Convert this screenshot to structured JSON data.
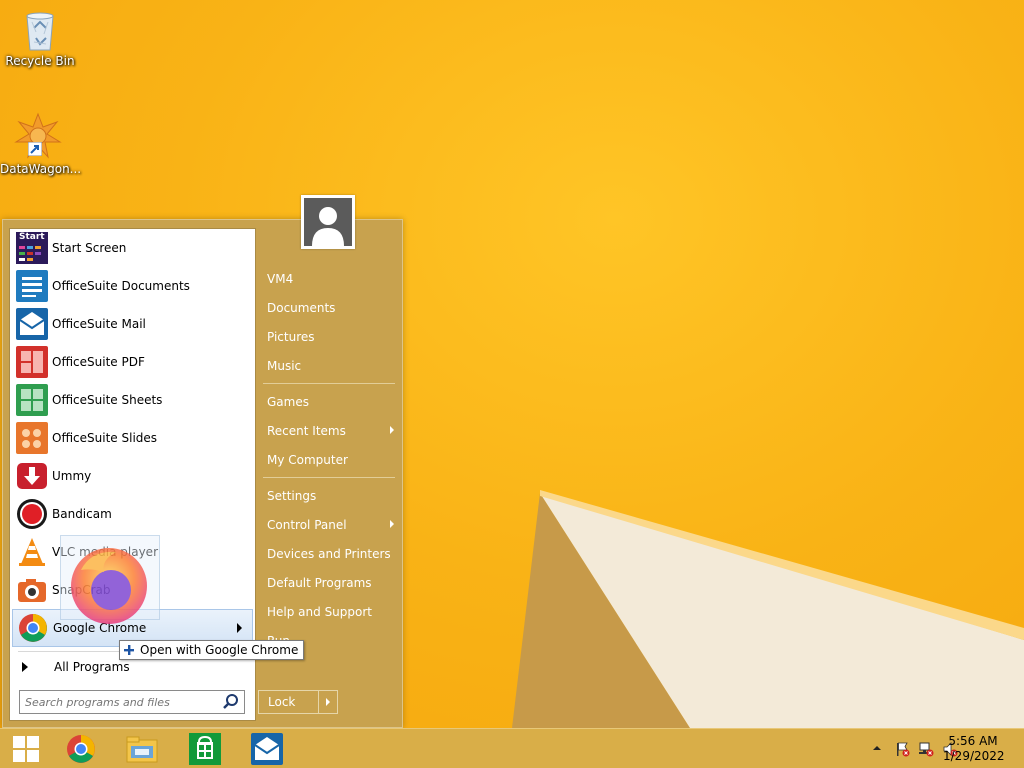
{
  "desktop": {
    "icons": [
      {
        "label": "Recycle Bin",
        "icon": "recycle-bin-icon"
      },
      {
        "label": "DataWagon...",
        "icon": "datawagon-icon"
      }
    ]
  },
  "start_menu": {
    "programs": [
      {
        "label": "Start Screen",
        "icon": "start-screen-icon",
        "tile_text": "Start"
      },
      {
        "label": "OfficeSuite Documents",
        "icon": "officesuite-documents-icon"
      },
      {
        "label": "OfficeSuite Mail",
        "icon": "officesuite-mail-icon"
      },
      {
        "label": "OfficeSuite PDF",
        "icon": "officesuite-pdf-icon"
      },
      {
        "label": "OfficeSuite Sheets",
        "icon": "officesuite-sheets-icon"
      },
      {
        "label": "OfficeSuite Slides",
        "icon": "officesuite-slides-icon"
      },
      {
        "label": "Ummy",
        "icon": "ummy-icon"
      },
      {
        "label": "Bandicam",
        "icon": "bandicam-icon"
      },
      {
        "label": "VLC media player",
        "icon": "vlc-icon"
      },
      {
        "label": "SnapCrab",
        "icon": "snapcrab-icon"
      },
      {
        "label": "Google Chrome",
        "icon": "chrome-icon",
        "has_submenu": true,
        "highlighted": true
      }
    ],
    "all_programs_label": "All Programs",
    "search": {
      "placeholder": "Search programs and files",
      "value": ""
    },
    "right_items": {
      "group1": [
        "VM4",
        "Documents",
        "Pictures",
        "Music"
      ],
      "group2": [
        {
          "label": "Games",
          "submenu": false
        },
        {
          "label": "Recent Items",
          "submenu": true
        },
        {
          "label": "My Computer",
          "submenu": false
        }
      ],
      "group3": [
        {
          "label": "Settings",
          "submenu": false
        },
        {
          "label": "Control Panel",
          "submenu": true
        },
        {
          "label": "Devices and Printers",
          "submenu": false
        },
        {
          "label": "Default Programs",
          "submenu": false
        },
        {
          "label": "Help and Support",
          "submenu": false
        },
        {
          "label": "Run...",
          "submenu": false
        }
      ]
    },
    "lock_label": "Lock"
  },
  "drag_tooltip": {
    "text": "Open with Google Chrome"
  },
  "taskbar": {
    "pinned": [
      "start-button",
      "chrome-icon",
      "file-explorer-icon",
      "store-icon",
      "officesuite-mail-icon"
    ],
    "clock": {
      "time": "5:56 AM",
      "date": "1/29/2022"
    }
  },
  "colors": {
    "menu_bg": "#c8a24e",
    "taskbar_bg": "#d9ae48",
    "desktop_bg": "#f9b316",
    "highlight": "#d4e4f6"
  }
}
